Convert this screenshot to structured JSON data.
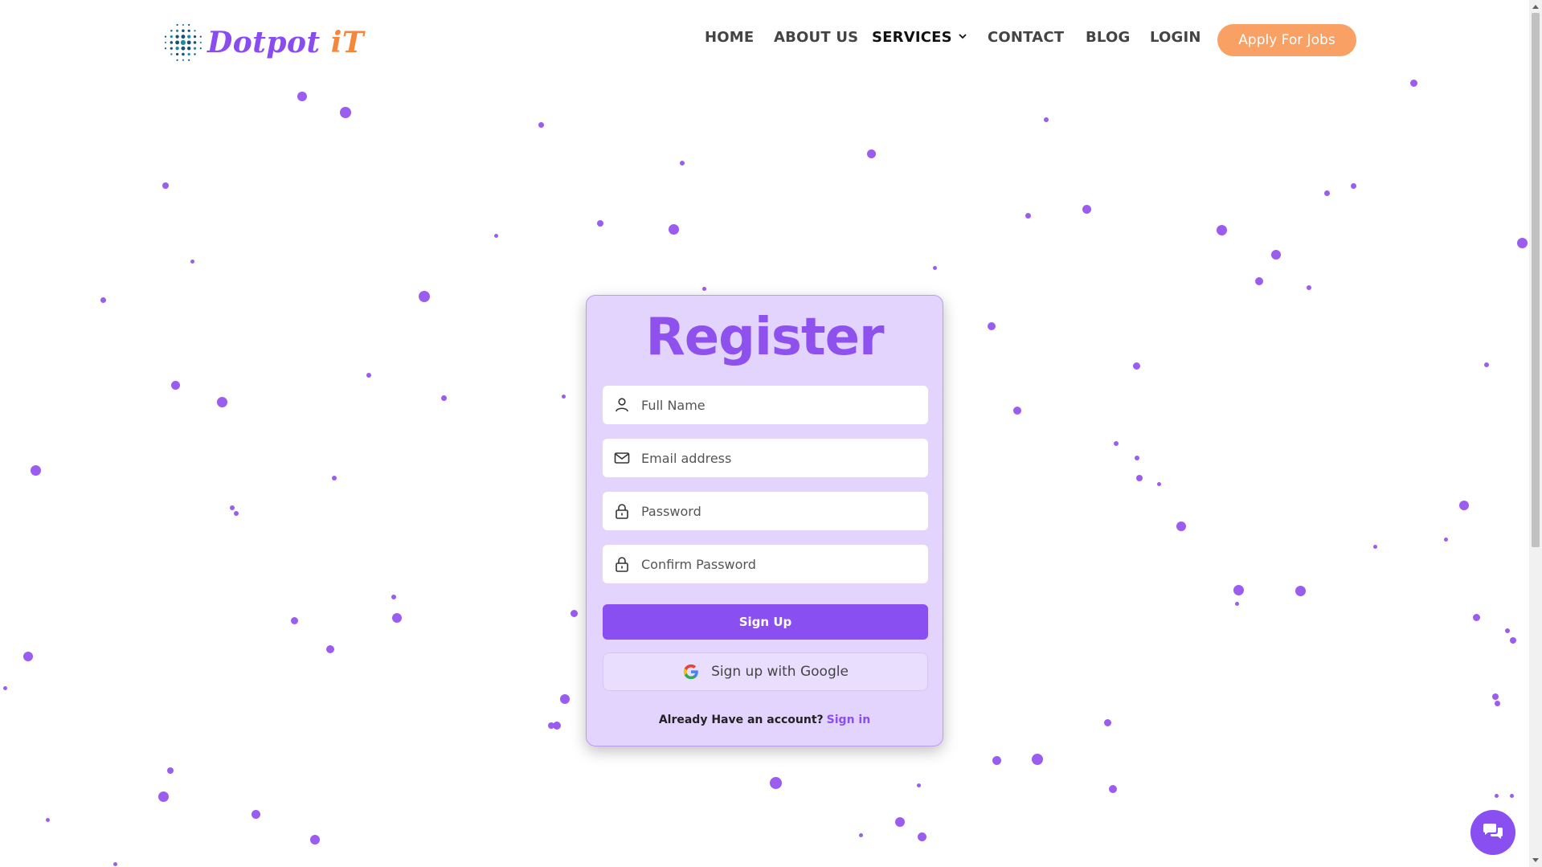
{
  "brand": {
    "name_part1": "Dotpot ",
    "name_part2": "iT",
    "color_primary": "#8a4cf0",
    "color_secondary": "#f5873a"
  },
  "nav": {
    "items": [
      {
        "label": "HOME"
      },
      {
        "label": "ABOUT US"
      },
      {
        "label": "SERVICES"
      },
      {
        "label": "CONTACT"
      },
      {
        "label": "BLOG"
      },
      {
        "label": "LOGIN"
      }
    ],
    "cta_label": "Apply For Jobs"
  },
  "register": {
    "title": "Register",
    "fields": {
      "full_name": {
        "placeholder": "Full Name",
        "icon": "user-icon"
      },
      "email": {
        "placeholder": "Email address",
        "icon": "mail-icon"
      },
      "password": {
        "placeholder": "Password",
        "icon": "lock-icon"
      },
      "confirm_password": {
        "placeholder": "Confirm Password",
        "icon": "lock-icon"
      }
    },
    "signup_label": "Sign Up",
    "google_label": "Sign up with Google",
    "account_prompt": "Already Have an account?",
    "signin_link": "Sign in"
  },
  "colors": {
    "accent": "#8a4ff0",
    "cta": "#f9a064",
    "card_bg": "#dfd0fd",
    "particle": "#9b5cf0"
  }
}
